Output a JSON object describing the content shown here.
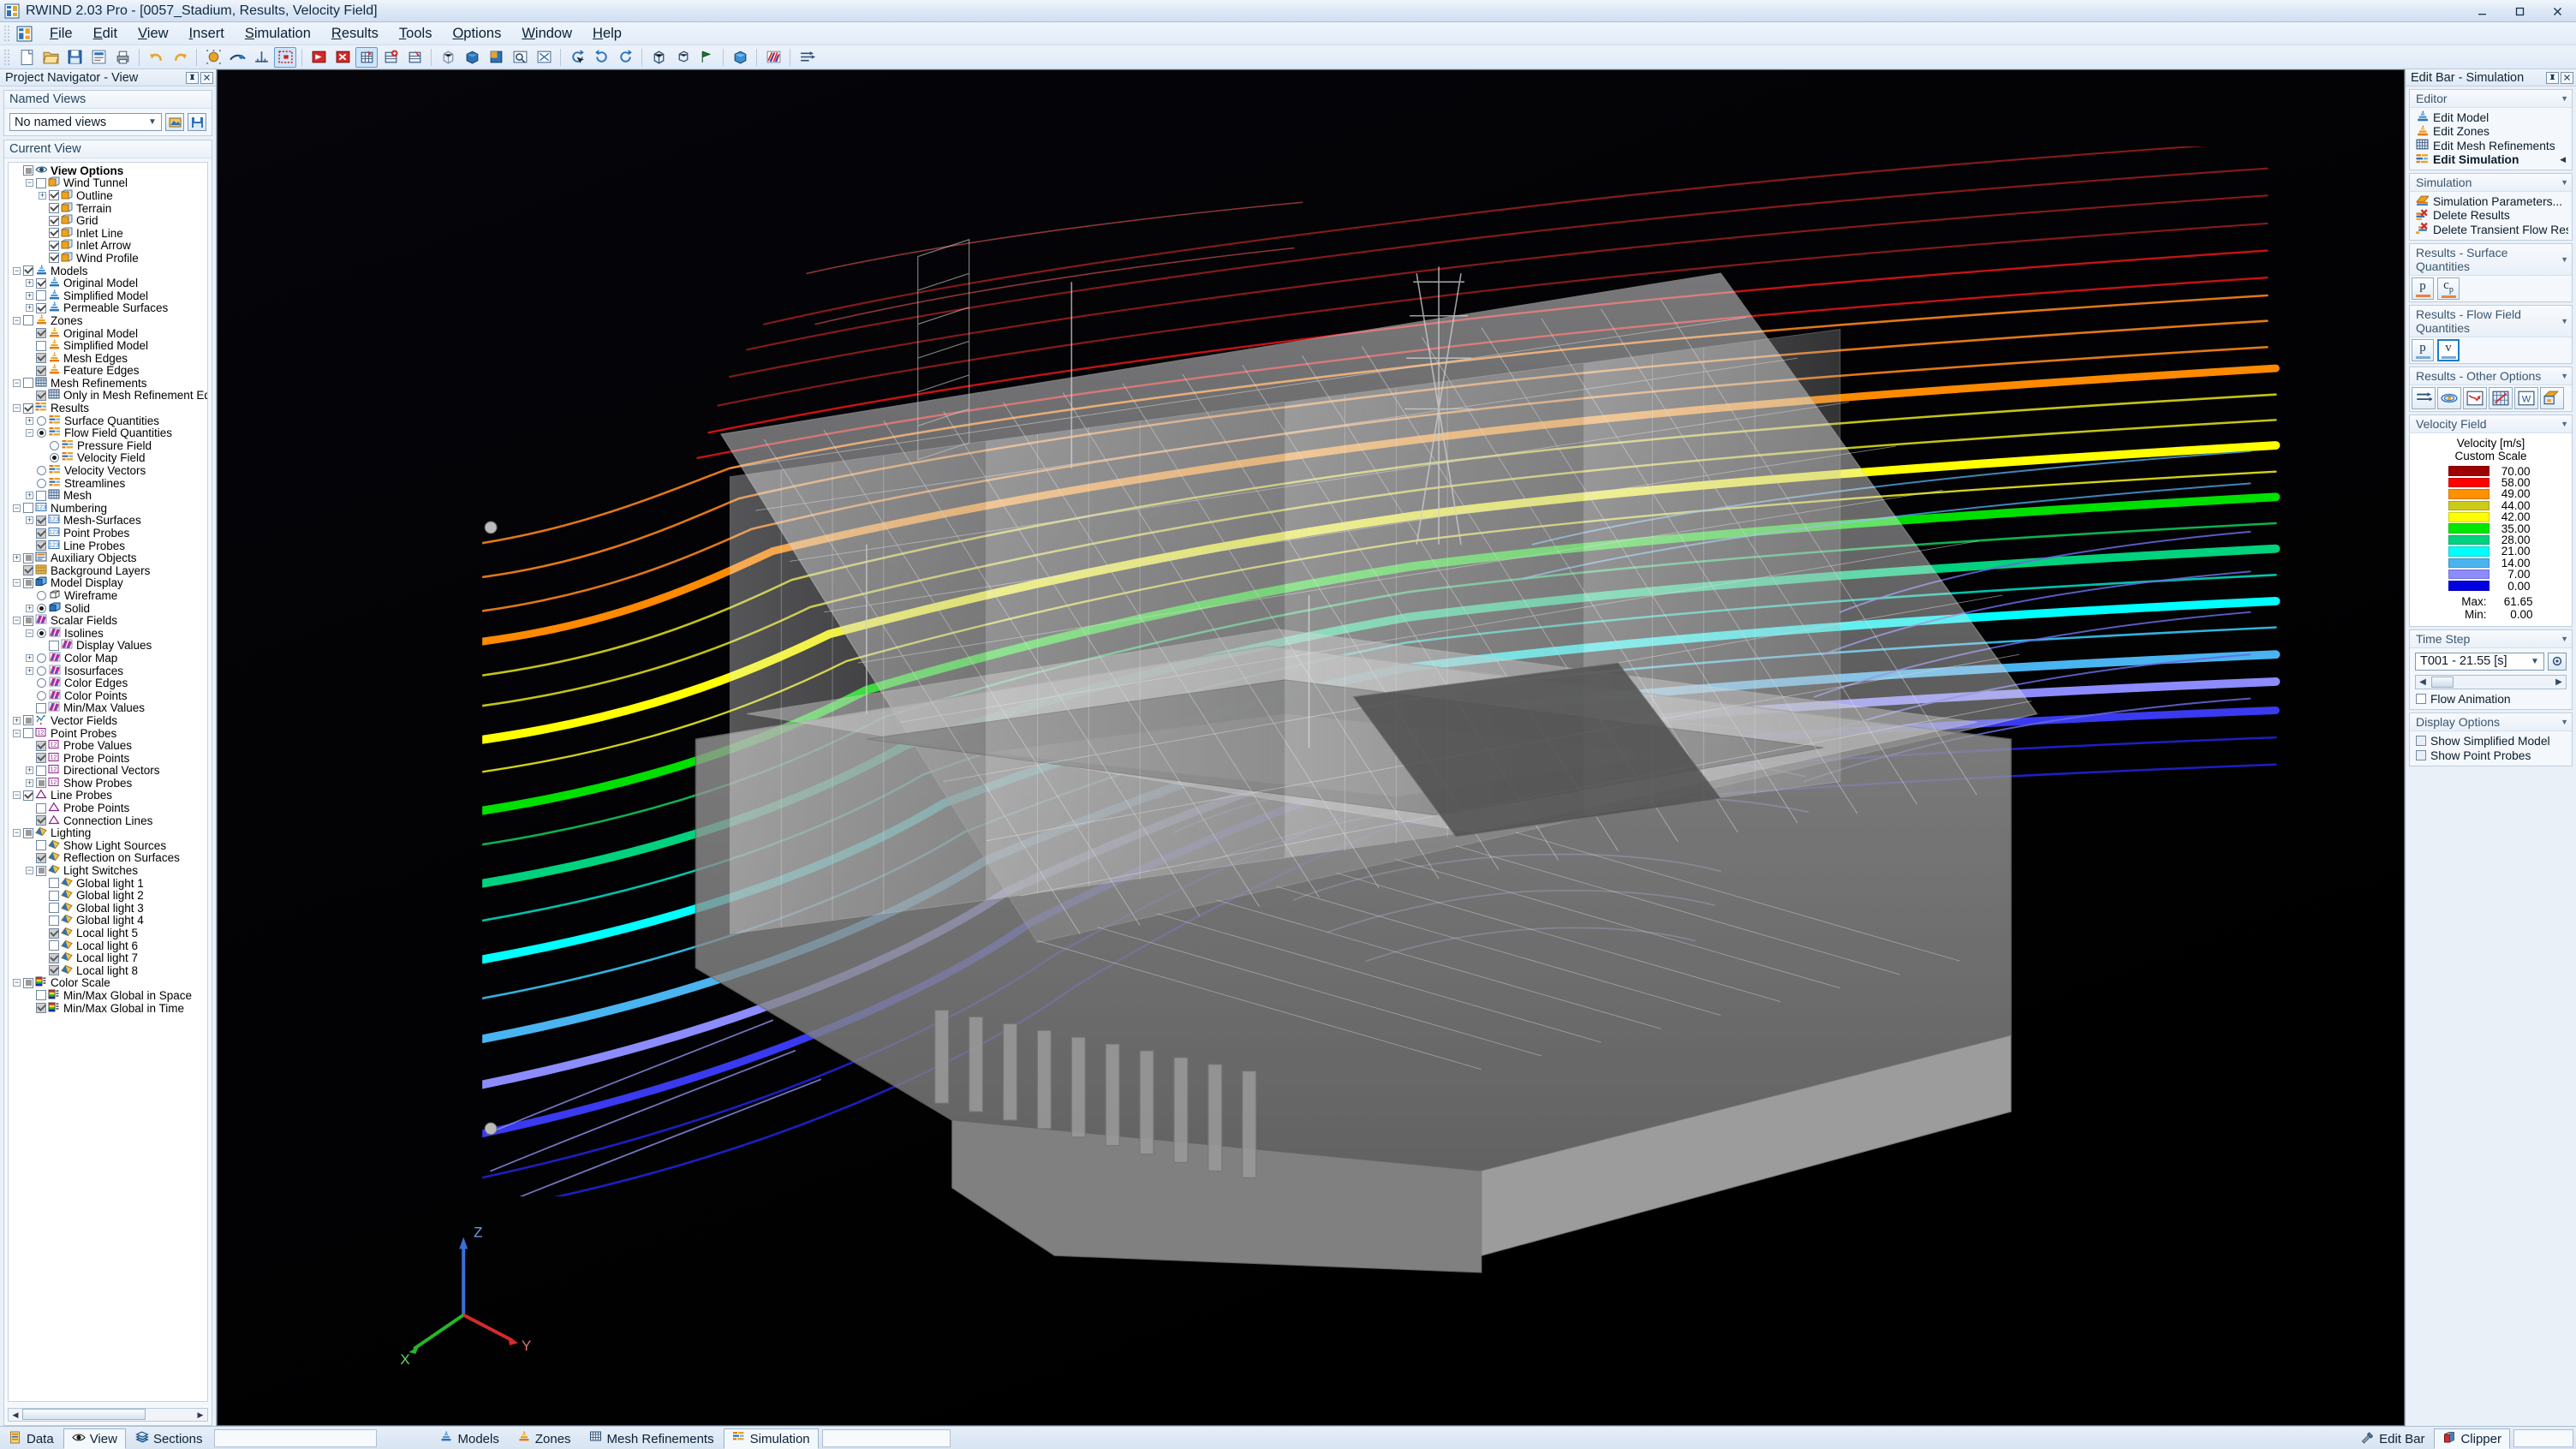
{
  "window": {
    "title": "RWIND 2.03 Pro - [0057_Stadium, Results, Velocity Field]",
    "app_icon": "rwind-app-icon",
    "minimize": "minimize-icon",
    "maximize": "maximize-icon",
    "close": "close-icon"
  },
  "menu": [
    {
      "label": "File",
      "accel": "F"
    },
    {
      "label": "Edit",
      "accel": "E"
    },
    {
      "label": "View",
      "accel": "V"
    },
    {
      "label": "Insert",
      "accel": "I"
    },
    {
      "label": "Simulation",
      "accel": "S"
    },
    {
      "label": "Results",
      "accel": "R"
    },
    {
      "label": "Tools",
      "accel": "T"
    },
    {
      "label": "Options",
      "accel": "O"
    },
    {
      "label": "Window",
      "accel": "W"
    },
    {
      "label": "Help",
      "accel": "H"
    }
  ],
  "toolbar": {
    "groups": [
      [
        "new-document-icon",
        "open-folder-icon",
        "save-disk-icon",
        "save-report-icon",
        "print-icon"
      ],
      [
        "undo-arrow-icon",
        "redo-arrow-icon"
      ],
      [
        "point-grid-icon",
        "snap-object-icon",
        "axis-snap-icon",
        "selection-rectangle-icon"
      ],
      [
        "model-view-icon",
        "delete-model-icon",
        "mesh-refine-icon",
        "mesh-add-icon",
        "mesh-edit-icon"
      ],
      [
        "wireframe-cube-icon",
        "shaded-cube-icon",
        "solid-cube-icon",
        "zoom-window-icon",
        "zoom-all-icon"
      ],
      [
        "rotate-pick-icon",
        "rotate-ccw-icon",
        "rotate-cw-icon"
      ],
      [
        "isometric-view-icon",
        "perspective-view-icon",
        "view-direction-icon"
      ],
      [
        "render-cube-icon"
      ],
      [
        "scalar-field-icon"
      ],
      [
        "vector-field-icon"
      ]
    ],
    "active": [
      "selection-rectangle-icon",
      "mesh-refine-icon"
    ]
  },
  "left_panel": {
    "title": "Project Navigator - View",
    "pin_button": "pin-icon",
    "close_button": "close-icon",
    "named_views": {
      "header": "Named Views",
      "selected": "No named views",
      "apply_button": "apply-view-icon",
      "save_button": "save-view-icon"
    },
    "current_view": {
      "header": "Current View"
    },
    "tree": [
      {
        "depth": 0,
        "label": "View Options",
        "ctrl": "solid",
        "icon": "view-options-icon",
        "bold": true,
        "exp": "none"
      },
      {
        "depth": 1,
        "label": "Wind Tunnel",
        "ctrl": "unchecked",
        "icon": "box-orange-icon",
        "exp": "minus"
      },
      {
        "depth": 2,
        "label": "Outline",
        "ctrl": "checked",
        "icon": "box-orange-icon",
        "exp": "plus"
      },
      {
        "depth": 2,
        "label": "Terrain",
        "ctrl": "checked",
        "icon": "box-orange-icon",
        "exp": "none"
      },
      {
        "depth": 2,
        "label": "Grid",
        "ctrl": "checked",
        "icon": "box-orange-icon",
        "exp": "none"
      },
      {
        "depth": 2,
        "label": "Inlet Line",
        "ctrl": "checked",
        "icon": "box-orange-icon",
        "exp": "none"
      },
      {
        "depth": 2,
        "label": "Inlet Arrow",
        "ctrl": "checked",
        "icon": "box-orange-icon",
        "exp": "none"
      },
      {
        "depth": 2,
        "label": "Wind Profile",
        "ctrl": "checked",
        "icon": "box-orange-icon",
        "exp": "none"
      },
      {
        "depth": 0,
        "label": "Models",
        "ctrl": "checked",
        "icon": "model-blue-icon",
        "exp": "minus"
      },
      {
        "depth": 1,
        "label": "Original Model",
        "ctrl": "checked",
        "icon": "model-blue-icon",
        "exp": "plus"
      },
      {
        "depth": 1,
        "label": "Simplified Model",
        "ctrl": "unchecked",
        "icon": "model-blue-icon",
        "exp": "plus"
      },
      {
        "depth": 1,
        "label": "Permeable Surfaces",
        "ctrl": "checked",
        "icon": "model-blue-icon",
        "exp": "plus"
      },
      {
        "depth": 0,
        "label": "Zones",
        "ctrl": "unchecked",
        "icon": "model-orange-icon",
        "exp": "minus"
      },
      {
        "depth": 1,
        "label": "Original Model",
        "ctrl": "grey",
        "icon": "model-orange-icon",
        "exp": "none"
      },
      {
        "depth": 1,
        "label": "Simplified Model",
        "ctrl": "unchecked",
        "icon": "model-orange-icon",
        "exp": "none"
      },
      {
        "depth": 1,
        "label": "Mesh Edges",
        "ctrl": "grey",
        "icon": "model-orange-icon",
        "exp": "none"
      },
      {
        "depth": 1,
        "label": "Feature Edges",
        "ctrl": "grey",
        "icon": "model-orange-icon",
        "exp": "none"
      },
      {
        "depth": 0,
        "label": "Mesh Refinements",
        "ctrl": "unchecked",
        "icon": "mesh-grid-icon",
        "exp": "minus"
      },
      {
        "depth": 1,
        "label": "Only in Mesh Refinement Edito",
        "ctrl": "grey",
        "icon": "mesh-grid-icon",
        "exp": "none"
      },
      {
        "depth": 0,
        "label": "Results",
        "ctrl": "checked",
        "icon": "results-icon",
        "exp": "minus"
      },
      {
        "depth": 1,
        "label": "Surface Quantities",
        "ctrl": "radio-off",
        "icon": "results-icon",
        "exp": "plus"
      },
      {
        "depth": 1,
        "label": "Flow Field Quantities",
        "ctrl": "radio-on",
        "icon": "results-icon",
        "exp": "minus"
      },
      {
        "depth": 2,
        "label": "Pressure Field",
        "ctrl": "radio-off",
        "icon": "results-icon",
        "exp": "none"
      },
      {
        "depth": 2,
        "label": "Velocity Field",
        "ctrl": "radio-on",
        "icon": "results-icon",
        "exp": "none"
      },
      {
        "depth": 1,
        "label": "Velocity Vectors",
        "ctrl": "radio-off",
        "icon": "results-icon",
        "exp": "none"
      },
      {
        "depth": 1,
        "label": "Streamlines",
        "ctrl": "radio-off",
        "icon": "results-icon",
        "exp": "none"
      },
      {
        "depth": 1,
        "label": "Mesh",
        "ctrl": "unchecked",
        "icon": "mesh-grid-icon",
        "exp": "plus"
      },
      {
        "depth": 0,
        "label": "Numbering",
        "ctrl": "unchecked",
        "icon": "numbering-icon",
        "exp": "minus"
      },
      {
        "depth": 1,
        "label": "Mesh-Surfaces",
        "ctrl": "grey",
        "icon": "numbering-icon",
        "exp": "plus"
      },
      {
        "depth": 1,
        "label": "Point Probes",
        "ctrl": "grey",
        "icon": "numbering-icon",
        "exp": "none"
      },
      {
        "depth": 1,
        "label": "Line Probes",
        "ctrl": "grey",
        "icon": "numbering-icon",
        "exp": "none"
      },
      {
        "depth": 0,
        "label": "Auxiliary Objects",
        "ctrl": "solid",
        "icon": "auxiliary-icon",
        "exp": "plus"
      },
      {
        "depth": 0,
        "label": "Background Layers",
        "ctrl": "grey",
        "icon": "layers-icon",
        "exp": "none"
      },
      {
        "depth": 0,
        "label": "Model Display",
        "ctrl": "solid",
        "icon": "cube-blue-icon",
        "exp": "minus"
      },
      {
        "depth": 1,
        "label": "Wireframe",
        "ctrl": "radio-off",
        "icon": "wireframe-icon",
        "exp": "none"
      },
      {
        "depth": 1,
        "label": "Solid",
        "ctrl": "radio-on",
        "icon": "cube-blue-icon",
        "exp": "plus"
      },
      {
        "depth": 0,
        "label": "Scalar Fields",
        "ctrl": "solid",
        "icon": "scalar-icon",
        "exp": "minus"
      },
      {
        "depth": 1,
        "label": "Isolines",
        "ctrl": "radio-on",
        "icon": "scalar-icon",
        "exp": "minus"
      },
      {
        "depth": 2,
        "label": "Display Values",
        "ctrl": "unchecked",
        "icon": "scalar-icon",
        "exp": "none"
      },
      {
        "depth": 1,
        "label": "Color Map",
        "ctrl": "radio-off",
        "icon": "scalar-icon",
        "exp": "plus"
      },
      {
        "depth": 1,
        "label": "Isosurfaces",
        "ctrl": "radio-off",
        "icon": "scalar-icon",
        "exp": "plus"
      },
      {
        "depth": 1,
        "label": "Color Edges",
        "ctrl": "radio-off",
        "icon": "scalar-icon",
        "exp": "none"
      },
      {
        "depth": 1,
        "label": "Color Points",
        "ctrl": "radio-off",
        "icon": "scalar-icon",
        "exp": "none"
      },
      {
        "depth": 1,
        "label": "Min/Max Values",
        "ctrl": "unchecked",
        "icon": "scalar-icon",
        "exp": "none"
      },
      {
        "depth": 0,
        "label": "Vector Fields",
        "ctrl": "solid",
        "icon": "vector-icon",
        "exp": "plus"
      },
      {
        "depth": 0,
        "label": "Point Probes",
        "ctrl": "unchecked",
        "icon": "probe12-icon",
        "exp": "minus"
      },
      {
        "depth": 1,
        "label": "Probe Values",
        "ctrl": "grey",
        "icon": "probe12-icon",
        "exp": "none"
      },
      {
        "depth": 1,
        "label": "Probe Points",
        "ctrl": "grey",
        "icon": "probe12-icon",
        "exp": "none"
      },
      {
        "depth": 1,
        "label": "Directional Vectors",
        "ctrl": "unchecked",
        "icon": "probe12-icon",
        "exp": "plus"
      },
      {
        "depth": 1,
        "label": "Show Probes",
        "ctrl": "solid",
        "icon": "probe12-icon",
        "exp": "plus"
      },
      {
        "depth": 0,
        "label": "Line Probes",
        "ctrl": "checked",
        "icon": "lineprobe-icon",
        "exp": "minus"
      },
      {
        "depth": 1,
        "label": "Probe Points",
        "ctrl": "unchecked",
        "icon": "lineprobe-icon",
        "exp": "none"
      },
      {
        "depth": 1,
        "label": "Connection Lines",
        "ctrl": "grey",
        "icon": "lineprobe-icon",
        "exp": "none"
      },
      {
        "depth": 0,
        "label": "Lighting",
        "ctrl": "solid",
        "icon": "light-icon",
        "exp": "minus"
      },
      {
        "depth": 1,
        "label": "Show Light Sources",
        "ctrl": "unchecked",
        "icon": "light-icon",
        "exp": "none"
      },
      {
        "depth": 1,
        "label": "Reflection on Surfaces",
        "ctrl": "grey",
        "icon": "light-icon",
        "exp": "none"
      },
      {
        "depth": 1,
        "label": "Light Switches",
        "ctrl": "solid",
        "icon": "light-icon",
        "exp": "minus"
      },
      {
        "depth": 2,
        "label": "Global light 1",
        "ctrl": "unchecked",
        "icon": "light-icon",
        "exp": "none"
      },
      {
        "depth": 2,
        "label": "Global light 2",
        "ctrl": "unchecked",
        "icon": "light-icon",
        "exp": "none"
      },
      {
        "depth": 2,
        "label": "Global light 3",
        "ctrl": "unchecked",
        "icon": "light-icon",
        "exp": "none"
      },
      {
        "depth": 2,
        "label": "Global light 4",
        "ctrl": "unchecked",
        "icon": "light-icon",
        "exp": "none"
      },
      {
        "depth": 2,
        "label": "Local light 5",
        "ctrl": "grey",
        "icon": "light-icon",
        "exp": "none"
      },
      {
        "depth": 2,
        "label": "Local light 6",
        "ctrl": "unchecked",
        "icon": "light-icon",
        "exp": "none"
      },
      {
        "depth": 2,
        "label": "Local light 7",
        "ctrl": "grey",
        "icon": "light-icon",
        "exp": "none"
      },
      {
        "depth": 2,
        "label": "Local light 8",
        "ctrl": "grey",
        "icon": "light-icon",
        "exp": "none"
      },
      {
        "depth": 0,
        "label": "Color Scale",
        "ctrl": "solid",
        "icon": "colorscale-icon",
        "exp": "minus"
      },
      {
        "depth": 1,
        "label": "Min/Max Global in Space",
        "ctrl": "unchecked",
        "icon": "colorscale-icon",
        "exp": "none"
      },
      {
        "depth": 1,
        "label": "Min/Max Global in Time",
        "ctrl": "grey",
        "icon": "colorscale-icon",
        "exp": "none"
      }
    ]
  },
  "right_panel": {
    "title": "Edit Bar - Simulation",
    "pin_button": "pin-icon",
    "close_button": "close-icon",
    "sections": {
      "editor": {
        "header": "Editor",
        "items": [
          {
            "label": "Edit Model",
            "icon": "model-blue-icon",
            "bold": false,
            "mark": ""
          },
          {
            "label": "Edit Zones",
            "icon": "model-orange-icon",
            "bold": false,
            "mark": ""
          },
          {
            "label": "Edit Mesh Refinements",
            "icon": "mesh-grid-icon",
            "bold": false,
            "mark": ""
          },
          {
            "label": "Edit Simulation",
            "icon": "results-icon",
            "bold": true,
            "mark": "◀"
          }
        ]
      },
      "simulation": {
        "header": "Simulation",
        "items": [
          {
            "label": "Simulation Parameters...",
            "icon": "sim-params-icon"
          },
          {
            "label": "Delete Results",
            "icon": "delete-results-icon"
          },
          {
            "label": "Delete Transient Flow Results...",
            "icon": "delete-transient-icon"
          }
        ]
      },
      "surface_quantities": {
        "header": "Results - Surface Quantities",
        "buttons": [
          {
            "name": "pressure-p-button",
            "label": "p",
            "sub": "",
            "underline": "#e8843c",
            "selected": false
          },
          {
            "name": "pressure-cp-button",
            "label": "c",
            "sub": "p",
            "underline": "#e8843c",
            "selected": false
          }
        ]
      },
      "flow_field_quantities": {
        "header": "Results - Flow Field Quantities",
        "buttons": [
          {
            "name": "flow-pressure-button",
            "label": "p",
            "sub": "",
            "underline": "#7fa9d4",
            "selected": false
          },
          {
            "name": "flow-velocity-button",
            "label": "v",
            "sub": "",
            "underline": "#7fa9d4",
            "selected": true
          }
        ]
      },
      "other_options": {
        "header": "Results - Other Options",
        "buttons": [
          "velocity-vectors-icon",
          "streamlines-icon",
          "result-diagram-icon",
          "result-graph-icon",
          "export-word-icon",
          "render-options-icon"
        ]
      },
      "velocity_field": {
        "header": "Velocity Field",
        "legend_title": "Velocity [m/s]",
        "legend_subtitle": "Custom Scale",
        "max_label": "Max:",
        "max_value": "61.65",
        "min_label": "Min:",
        "min_value": "0.00"
      },
      "time_step": {
        "header": "Time Step",
        "selected": "T001 - 21.55 [s]",
        "settings_button": "gear-icon",
        "prev_button": "chevron-left-icon",
        "next_button": "chevron-right-icon",
        "flow_animation_label": "Flow Animation",
        "flow_animation_checked": false
      },
      "display_options": {
        "header": "Display Options",
        "items": [
          {
            "label": "Show Simplified Model",
            "checked": false
          },
          {
            "label": "Show Point Probes",
            "checked": false
          }
        ]
      }
    }
  },
  "chart_data": {
    "type": "contour",
    "title": "Velocity [m/s]",
    "subtitle": "Custom Scale",
    "scale_mode": "Custom Scale",
    "unit": "m/s",
    "levels": [
      70.0,
      58.0,
      49.0,
      44.0,
      42.0,
      35.0,
      28.0,
      21.0,
      14.0,
      7.0,
      0.0
    ],
    "level_labels": [
      "70.00",
      "58.00",
      "49.00",
      "44.00",
      "42.00",
      "35.00",
      "28.00",
      "21.00",
      "14.00",
      "7.00",
      "0.00"
    ],
    "colors": [
      "#9e0000",
      "#ff0000",
      "#ff9000",
      "#cbcb18",
      "#ffff00",
      "#00e800",
      "#00d27e",
      "#00ffff",
      "#4ab4f0",
      "#8c8cff",
      "#0000e0"
    ],
    "max": 61.65,
    "min": 0.0,
    "legend_position": "right-panel",
    "scene": "stadium wind-tunnel CFD velocity isoline contour section plane"
  },
  "viewport": {
    "axis_x": "X",
    "axis_y": "Y",
    "axis_z": "Z",
    "background": "#000000"
  },
  "bottom_bar": {
    "left_tabs": [
      {
        "label": "Data",
        "icon": "data-icon",
        "selected": false
      },
      {
        "label": "View",
        "icon": "eye-icon",
        "selected": true
      },
      {
        "label": "Sections",
        "icon": "sections-icon",
        "selected": false
      }
    ],
    "center_tabs": [
      {
        "label": "Models",
        "icon": "model-blue-icon",
        "selected": false
      },
      {
        "label": "Zones",
        "icon": "model-orange-icon",
        "selected": false
      },
      {
        "label": "Mesh Refinements",
        "icon": "mesh-grid-icon",
        "selected": false
      },
      {
        "label": "Simulation",
        "icon": "results-icon",
        "selected": true
      }
    ],
    "right_tabs": [
      {
        "label": "Edit Bar",
        "icon": "tools-icon",
        "selected": false
      },
      {
        "label": "Clipper",
        "icon": "clipper-icon",
        "selected": true
      }
    ]
  }
}
